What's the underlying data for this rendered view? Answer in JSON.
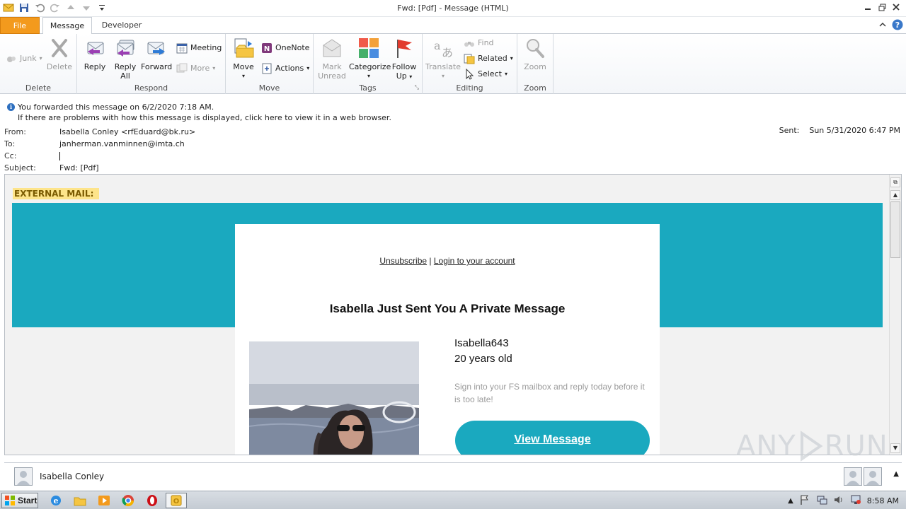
{
  "window": {
    "title": "Fwd: [Pdf]    - Message (HTML)"
  },
  "tabs": {
    "file": "File",
    "message": "Message",
    "developer": "Developer"
  },
  "ribbon": {
    "delete_group": {
      "junk": "Junk",
      "delete": "Delete",
      "label": "Delete"
    },
    "respond_group": {
      "reply": "Reply",
      "reply_all_1": "Reply",
      "reply_all_2": "All",
      "forward": "Forward",
      "meeting": "Meeting",
      "more": "More",
      "label": "Respond"
    },
    "move_group": {
      "move": "Move",
      "onenote": "OneNote",
      "actions": "Actions",
      "label": "Move"
    },
    "tags_group": {
      "mark_unread_1": "Mark",
      "mark_unread_2": "Unread",
      "categorize": "Categorize",
      "follow_up_1": "Follow",
      "follow_up_2": "Up",
      "label": "Tags"
    },
    "editing_group": {
      "translate": "Translate",
      "find": "Find",
      "related": "Related",
      "select": "Select",
      "label": "Editing"
    },
    "zoom_group": {
      "zoom": "Zoom",
      "label": "Zoom"
    }
  },
  "infobar": {
    "line1": "You forwarded this message on 6/2/2020 7:18 AM.",
    "line2": "If there are problems with how this message is displayed, click here to view it in a web browser."
  },
  "headers": {
    "from_label": "From:",
    "from_value": "Isabella Conley <rfEduard@bk.ru>",
    "to_label": "To:",
    "to_value": "janherman.vanminnen@imta.ch",
    "cc_label": "Cc:",
    "subject_label": "Subject:",
    "subject_value": "Fwd: [Pdf]",
    "sent_label": "Sent:",
    "sent_value": "Sun 5/31/2020 6:47 PM"
  },
  "email": {
    "external_tag": "EXTERNAL MAIL:",
    "unsubscribe": "Unsubscribe",
    "separator": "|",
    "login": "Login to your account",
    "headline": "Isabella Just Sent You A Private Message",
    "username": "Isabella643",
    "age": "20 years old",
    "note": "Sign into your FS mailbox and reply today before it is too late!",
    "button": "View Message"
  },
  "people_pane": {
    "name": "Isabella Conley"
  },
  "taskbar": {
    "start": "Start",
    "time": "8:58 AM"
  },
  "watermark": {
    "text_left": "ANY",
    "text_right": "RUN"
  },
  "colors": {
    "accent_teal": "#1aa9bf",
    "file_tab": "#f39a1d",
    "external_highlight": "#fde48a"
  }
}
